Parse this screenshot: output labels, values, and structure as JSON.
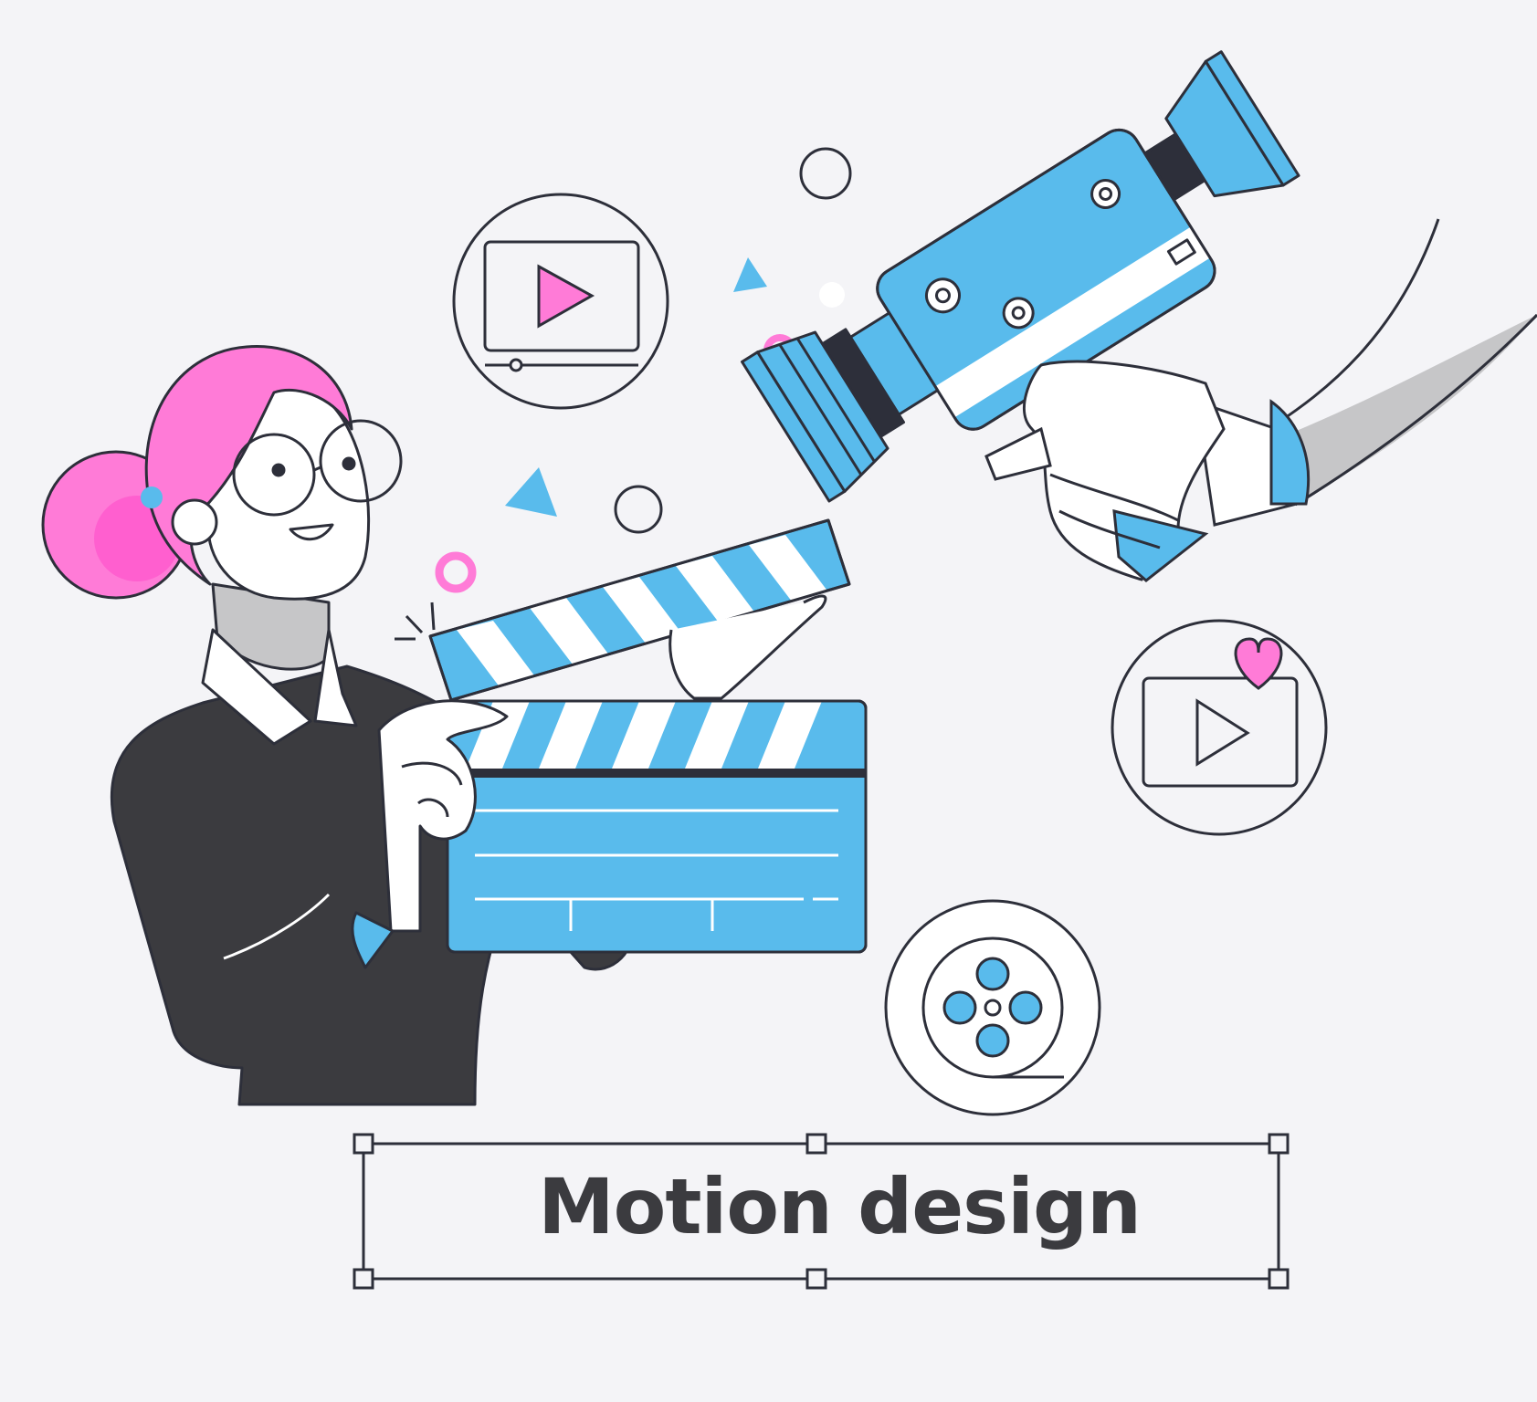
{
  "caption": {
    "title": "Motion design"
  },
  "colors": {
    "background": "#F4F4F7",
    "outline": "#2D2F3A",
    "blue": "#59BBEC",
    "pink": "#FF7BD7",
    "dark": "#3B3B3F",
    "gray": "#C6C6C8",
    "white": "#FFFFFF"
  },
  "icons": [
    "video-player-icon",
    "film-reel-icon",
    "video-heart-icon",
    "clapperboard-icon",
    "movie-camera-icon"
  ]
}
